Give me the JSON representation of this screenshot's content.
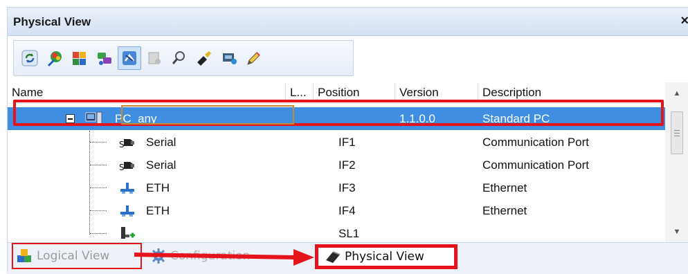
{
  "panel": {
    "title": "Physical View",
    "close_label": "×"
  },
  "toolbar": {
    "buttons": [
      {
        "icon": "refresh-icon",
        "active": false
      },
      {
        "icon": "color-palette-icon",
        "active": false
      },
      {
        "icon": "hardware-catalog-icon",
        "active": false
      },
      {
        "icon": "network-view-icon",
        "active": false
      },
      {
        "icon": "connect-view-icon",
        "active": true
      },
      {
        "icon": "disabled-module-icon",
        "active": false
      },
      {
        "icon": "find-icon",
        "active": false
      },
      {
        "icon": "module-plug-icon",
        "active": false
      },
      {
        "icon": "device-icon",
        "active": false
      },
      {
        "icon": "edit-pencil-icon",
        "active": false
      }
    ]
  },
  "table": {
    "columns": [
      "Name",
      "L...",
      "Position",
      "Version",
      "Description"
    ],
    "rows": [
      {
        "name": "PC_any",
        "position": "",
        "version": "1.1.0.0",
        "description": "Standard PC",
        "icon": "pc-icon",
        "level": 0,
        "selected": true
      },
      {
        "name": "Serial",
        "position": "IF1",
        "version": "",
        "description": "Communication Port",
        "icon": "serial-port-icon",
        "level": 1,
        "selected": false
      },
      {
        "name": "Serial",
        "position": "IF2",
        "version": "",
        "description": "Communication Port",
        "icon": "serial-port-icon",
        "level": 1,
        "selected": false
      },
      {
        "name": "ETH",
        "position": "IF3",
        "version": "",
        "description": "Ethernet",
        "icon": "ethernet-icon",
        "level": 1,
        "selected": false
      },
      {
        "name": "ETH",
        "position": "IF4",
        "version": "",
        "description": "Ethernet",
        "icon": "ethernet-icon",
        "level": 1,
        "selected": false
      },
      {
        "name": "",
        "position": "SL1",
        "version": "",
        "description": "",
        "icon": "slot-add-icon",
        "level": 1,
        "selected": false
      }
    ]
  },
  "tabs": {
    "logical": "Logical View",
    "configuration": "Configuration",
    "physical": "Physical View"
  },
  "colors": {
    "highlight_red": "#e5131b",
    "selection_blue": "#3f8ee2"
  }
}
